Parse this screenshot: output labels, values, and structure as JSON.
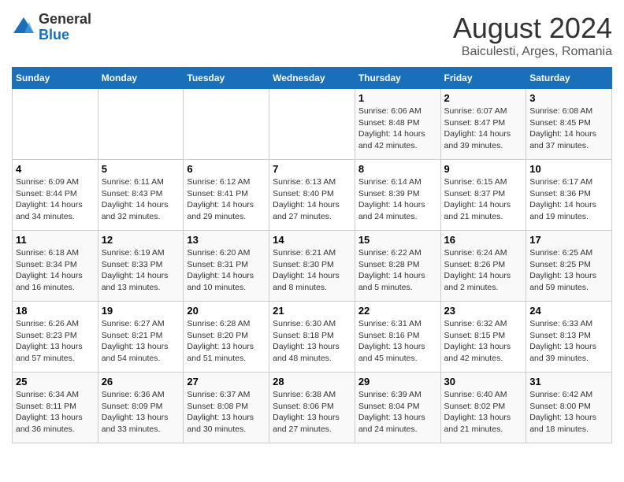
{
  "header": {
    "logo_line1": "General",
    "logo_line2": "Blue",
    "month_title": "August 2024",
    "subtitle": "Baiculesti, Arges, Romania"
  },
  "weekdays": [
    "Sunday",
    "Monday",
    "Tuesday",
    "Wednesday",
    "Thursday",
    "Friday",
    "Saturday"
  ],
  "weeks": [
    [
      {
        "day": "",
        "info": ""
      },
      {
        "day": "",
        "info": ""
      },
      {
        "day": "",
        "info": ""
      },
      {
        "day": "",
        "info": ""
      },
      {
        "day": "1",
        "info": "Sunrise: 6:06 AM\nSunset: 8:48 PM\nDaylight: 14 hours and 42 minutes."
      },
      {
        "day": "2",
        "info": "Sunrise: 6:07 AM\nSunset: 8:47 PM\nDaylight: 14 hours and 39 minutes."
      },
      {
        "day": "3",
        "info": "Sunrise: 6:08 AM\nSunset: 8:45 PM\nDaylight: 14 hours and 37 minutes."
      }
    ],
    [
      {
        "day": "4",
        "info": "Sunrise: 6:09 AM\nSunset: 8:44 PM\nDaylight: 14 hours and 34 minutes."
      },
      {
        "day": "5",
        "info": "Sunrise: 6:11 AM\nSunset: 8:43 PM\nDaylight: 14 hours and 32 minutes."
      },
      {
        "day": "6",
        "info": "Sunrise: 6:12 AM\nSunset: 8:41 PM\nDaylight: 14 hours and 29 minutes."
      },
      {
        "day": "7",
        "info": "Sunrise: 6:13 AM\nSunset: 8:40 PM\nDaylight: 14 hours and 27 minutes."
      },
      {
        "day": "8",
        "info": "Sunrise: 6:14 AM\nSunset: 8:39 PM\nDaylight: 14 hours and 24 minutes."
      },
      {
        "day": "9",
        "info": "Sunrise: 6:15 AM\nSunset: 8:37 PM\nDaylight: 14 hours and 21 minutes."
      },
      {
        "day": "10",
        "info": "Sunrise: 6:17 AM\nSunset: 8:36 PM\nDaylight: 14 hours and 19 minutes."
      }
    ],
    [
      {
        "day": "11",
        "info": "Sunrise: 6:18 AM\nSunset: 8:34 PM\nDaylight: 14 hours and 16 minutes."
      },
      {
        "day": "12",
        "info": "Sunrise: 6:19 AM\nSunset: 8:33 PM\nDaylight: 14 hours and 13 minutes."
      },
      {
        "day": "13",
        "info": "Sunrise: 6:20 AM\nSunset: 8:31 PM\nDaylight: 14 hours and 10 minutes."
      },
      {
        "day": "14",
        "info": "Sunrise: 6:21 AM\nSunset: 8:30 PM\nDaylight: 14 hours and 8 minutes."
      },
      {
        "day": "15",
        "info": "Sunrise: 6:22 AM\nSunset: 8:28 PM\nDaylight: 14 hours and 5 minutes."
      },
      {
        "day": "16",
        "info": "Sunrise: 6:24 AM\nSunset: 8:26 PM\nDaylight: 14 hours and 2 minutes."
      },
      {
        "day": "17",
        "info": "Sunrise: 6:25 AM\nSunset: 8:25 PM\nDaylight: 13 hours and 59 minutes."
      }
    ],
    [
      {
        "day": "18",
        "info": "Sunrise: 6:26 AM\nSunset: 8:23 PM\nDaylight: 13 hours and 57 minutes."
      },
      {
        "day": "19",
        "info": "Sunrise: 6:27 AM\nSunset: 8:21 PM\nDaylight: 13 hours and 54 minutes."
      },
      {
        "day": "20",
        "info": "Sunrise: 6:28 AM\nSunset: 8:20 PM\nDaylight: 13 hours and 51 minutes."
      },
      {
        "day": "21",
        "info": "Sunrise: 6:30 AM\nSunset: 8:18 PM\nDaylight: 13 hours and 48 minutes."
      },
      {
        "day": "22",
        "info": "Sunrise: 6:31 AM\nSunset: 8:16 PM\nDaylight: 13 hours and 45 minutes."
      },
      {
        "day": "23",
        "info": "Sunrise: 6:32 AM\nSunset: 8:15 PM\nDaylight: 13 hours and 42 minutes."
      },
      {
        "day": "24",
        "info": "Sunrise: 6:33 AM\nSunset: 8:13 PM\nDaylight: 13 hours and 39 minutes."
      }
    ],
    [
      {
        "day": "25",
        "info": "Sunrise: 6:34 AM\nSunset: 8:11 PM\nDaylight: 13 hours and 36 minutes."
      },
      {
        "day": "26",
        "info": "Sunrise: 6:36 AM\nSunset: 8:09 PM\nDaylight: 13 hours and 33 minutes."
      },
      {
        "day": "27",
        "info": "Sunrise: 6:37 AM\nSunset: 8:08 PM\nDaylight: 13 hours and 30 minutes."
      },
      {
        "day": "28",
        "info": "Sunrise: 6:38 AM\nSunset: 8:06 PM\nDaylight: 13 hours and 27 minutes."
      },
      {
        "day": "29",
        "info": "Sunrise: 6:39 AM\nSunset: 8:04 PM\nDaylight: 13 hours and 24 minutes."
      },
      {
        "day": "30",
        "info": "Sunrise: 6:40 AM\nSunset: 8:02 PM\nDaylight: 13 hours and 21 minutes."
      },
      {
        "day": "31",
        "info": "Sunrise: 6:42 AM\nSunset: 8:00 PM\nDaylight: 13 hours and 18 minutes."
      }
    ]
  ]
}
